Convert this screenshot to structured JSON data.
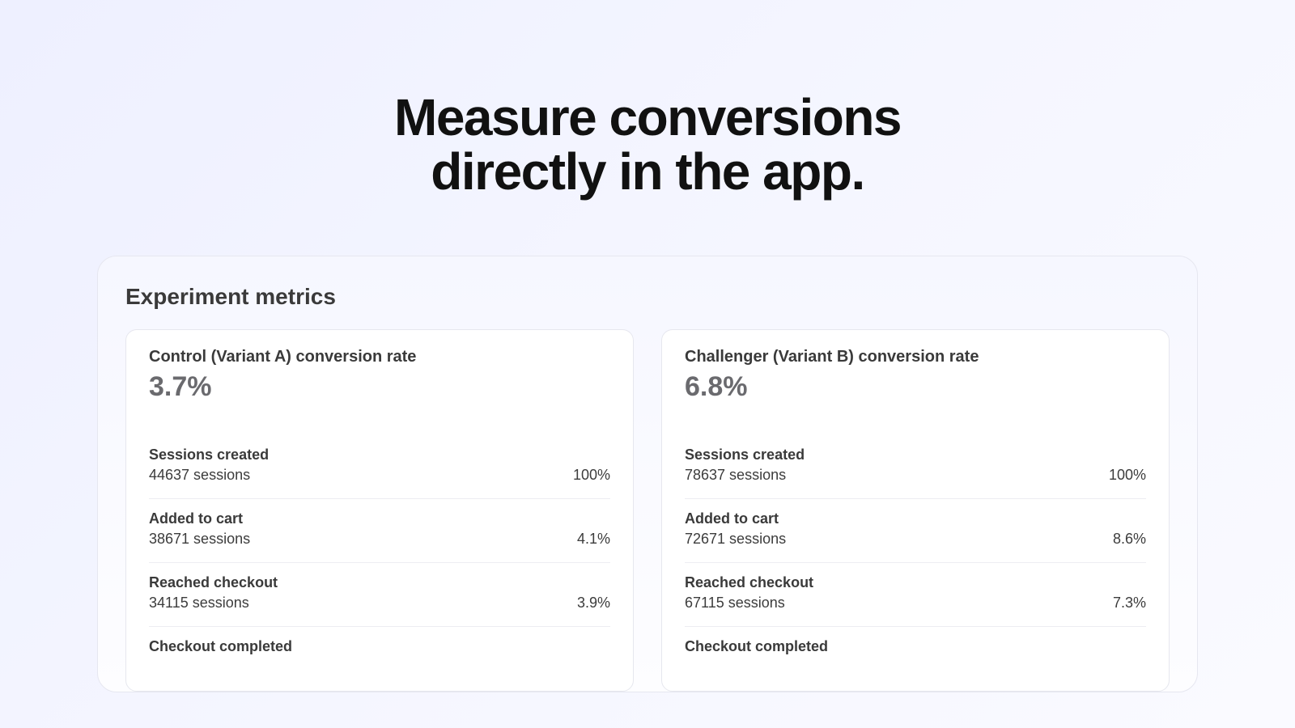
{
  "headline_line1": "Measure conversions",
  "headline_line2": "directly in the app.",
  "panel": {
    "heading": "Experiment metrics",
    "variants": [
      {
        "title": "Control (Variant A) conversion rate",
        "rate": "3.7%",
        "steps": [
          {
            "label": "Sessions created",
            "count": "44637 sessions",
            "pct": "100%"
          },
          {
            "label": "Added to cart",
            "count": "38671 sessions",
            "pct": "4.1%"
          },
          {
            "label": "Reached checkout",
            "count": "34115 sessions",
            "pct": "3.9%"
          },
          {
            "label": "Checkout completed",
            "count": "",
            "pct": ""
          }
        ]
      },
      {
        "title": "Challenger  (Variant B)  conversion rate",
        "rate": "6.8%",
        "steps": [
          {
            "label": "Sessions created",
            "count": "78637 sessions",
            "pct": "100%"
          },
          {
            "label": "Added to cart",
            "count": "72671 sessions",
            "pct": "8.6%"
          },
          {
            "label": "Reached checkout",
            "count": "67115 sessions",
            "pct": "7.3%"
          },
          {
            "label": "Checkout completed",
            "count": "",
            "pct": ""
          }
        ]
      }
    ]
  }
}
